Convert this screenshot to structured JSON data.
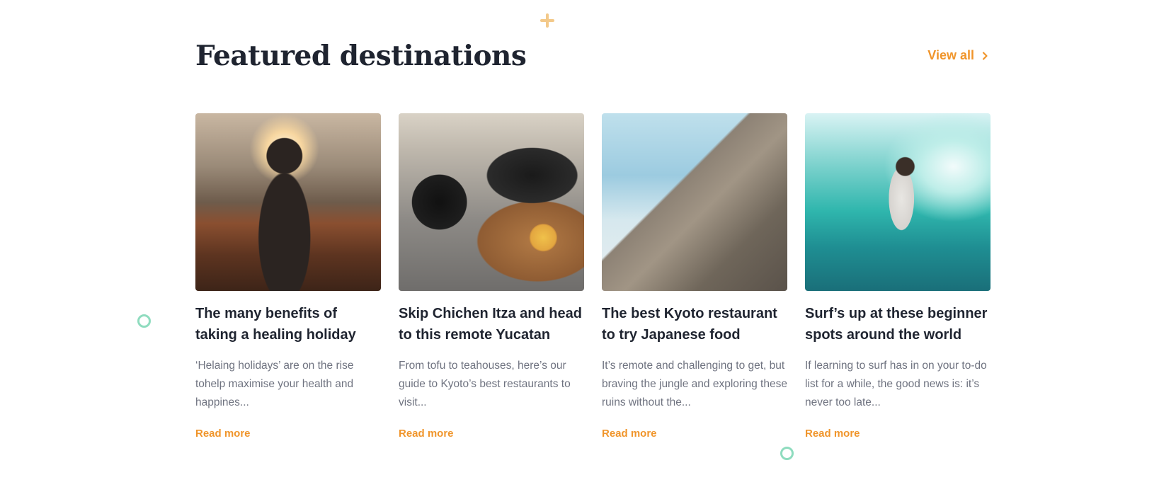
{
  "section": {
    "title": "Featured destinations",
    "view_all_label": "View all"
  },
  "cards": [
    {
      "title": "The many benefits of taking a healing holiday",
      "description": "‘Helaing holidays’ are on the rise tohelp maximise your health and happines...",
      "cta": "Read more"
    },
    {
      "title": "Skip Chichen Itza and head to this remote Yucatan",
      "description": "From tofu to teahouses, here’s our guide to Kyoto’s best restaurants to visit...",
      "cta": "Read more"
    },
    {
      "title": "The best Kyoto restaurant to try Japanese food",
      "description": "It’s remote and challenging to get, but braving the jungle and exploring these ruins without the...",
      "cta": "Read more"
    },
    {
      "title": "Surf’s up at these beginner spots around the world",
      "description": "If learning to surf has in on your to-do list for a while, the good news is: it’s never too late...",
      "cta": "Read more"
    }
  ],
  "colors": {
    "accent": "#f0952b",
    "heading": "#1f2430",
    "body_text": "#6f7380",
    "deco_plus": "#f3c98a",
    "deco_ring": "#8fdcbf"
  },
  "icons": {
    "view_all": "chevron-right-icon"
  }
}
